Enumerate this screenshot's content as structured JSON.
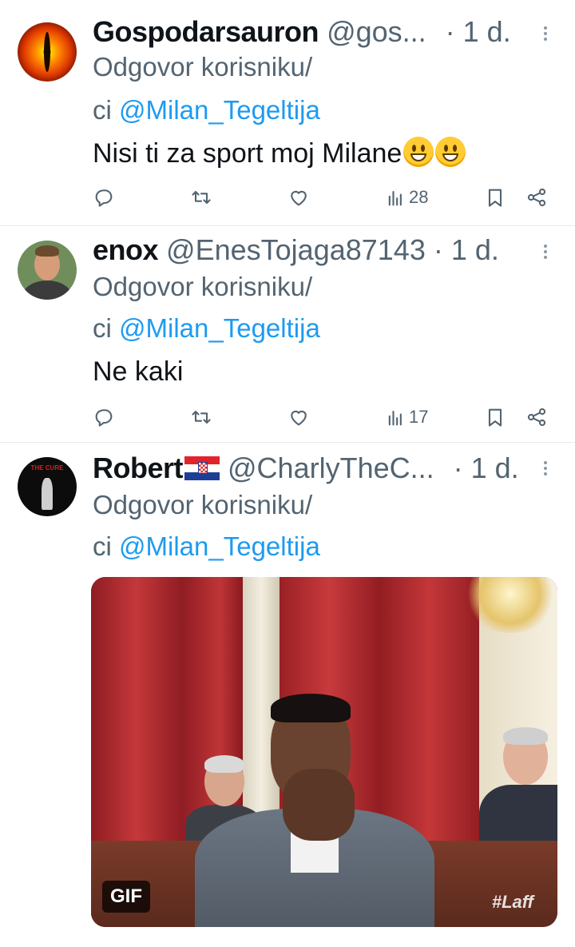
{
  "tweets": [
    {
      "name": "Gospodarsauron",
      "handle": "@gos...",
      "time": "· 1 d.",
      "reply_prefix": "Odgovor korisniku/",
      "reply_prefix2": "ci",
      "mention": "@Milan_Tegeltija",
      "text": "Nisi ti za sport moj Milane",
      "emoji": [
        "grinning-face",
        "grinning-face"
      ],
      "views": "28"
    },
    {
      "name": "enox",
      "handle": "@EnesTojaga87143",
      "time": "· 1 d.",
      "reply_prefix": "Odgovor korisniku/",
      "reply_prefix2": "ci",
      "mention": "@Milan_Tegeltija",
      "text": "Ne kaki",
      "views": "17"
    },
    {
      "name": "Robert",
      "flag": "croatia-flag",
      "handle": "@CharlyTheC...",
      "time": "· 1 d.",
      "reply_prefix": "Odgovor korisniku/",
      "reply_prefix2": "ci",
      "mention": "@Milan_Tegeltija",
      "media": {
        "badge": "GIF",
        "watermark": "#Laff"
      }
    }
  ],
  "icons": {
    "reply": "reply-icon",
    "retweet": "retweet-icon",
    "like": "heart-icon",
    "views": "views-icon",
    "bookmark": "bookmark-icon",
    "share": "share-icon",
    "more": "more-icon"
  },
  "colors": {
    "link": "#1d9bf0",
    "secondary_text": "#536471",
    "primary_text": "#0f1419"
  }
}
